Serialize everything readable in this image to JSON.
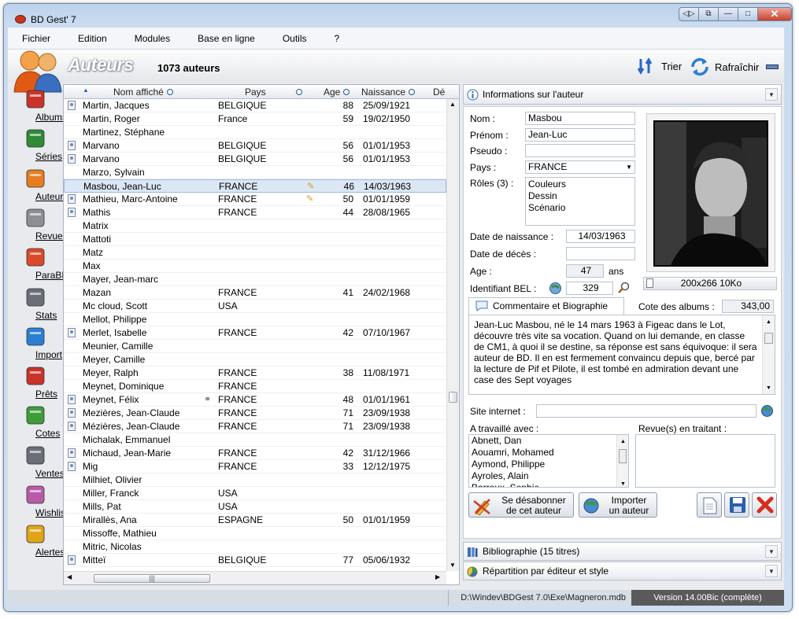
{
  "window": {
    "title": "BD Gest' 7"
  },
  "menu": [
    "Fichier",
    "Edition",
    "Modules",
    "Base en ligne",
    "Outils",
    "?"
  ],
  "header": {
    "title": "Auteurs",
    "count": "1073 auteurs",
    "sort_label": "Trier",
    "refresh_label": "Rafraîchir"
  },
  "sidebar": [
    {
      "label": "Albums",
      "icon": "albums-icon"
    },
    {
      "label": "Séries",
      "icon": "series-icon"
    },
    {
      "label": "Auteurs",
      "icon": "authors-icon"
    },
    {
      "label": "Revues",
      "icon": "magazines-icon"
    },
    {
      "label": "ParaBD",
      "icon": "parabd-icon"
    },
    {
      "label": "Stats",
      "icon": "stats-icon"
    },
    {
      "label": "Import",
      "icon": "import-icon"
    },
    {
      "label": "Prêts",
      "icon": "loans-icon"
    },
    {
      "label": "Cotes",
      "icon": "prices-icon"
    },
    {
      "label": "Ventes",
      "icon": "sales-icon"
    },
    {
      "label": "Wishlist",
      "icon": "wishlist-icon"
    },
    {
      "label": "Alertes",
      "icon": "alerts-icon"
    }
  ],
  "list": {
    "columns": {
      "name": "Nom affiché",
      "country": "Pays",
      "age": "Age",
      "birth": "Naissance",
      "death": "Dé"
    },
    "rows": [
      {
        "name": "Martin, Jacques",
        "country": "BELGIQUE",
        "age": "88",
        "birth": "25/09/1921",
        "icon": true
      },
      {
        "name": "Martin, Roger",
        "country": "France",
        "age": "59",
        "birth": "19/02/1950",
        "icon": false
      },
      {
        "name": "Martinez, Stéphane",
        "country": "",
        "age": "",
        "birth": "",
        "icon": false
      },
      {
        "name": "Marvano",
        "country": "BELGIQUE",
        "age": "56",
        "birth": "01/01/1953",
        "icon": true
      },
      {
        "name": "Marvano",
        "country": "BELGIQUE",
        "age": "56",
        "birth": "01/01/1953",
        "icon": true
      },
      {
        "name": "Marzo, Sylvain",
        "country": "",
        "age": "",
        "birth": "",
        "icon": false
      },
      {
        "name": "Masbou, Jean-Luc",
        "country": "FRANCE",
        "age": "46",
        "birth": "14/03/1963",
        "icon": false,
        "selected": true,
        "mark": "pen"
      },
      {
        "name": "Mathieu, Marc-Antoine",
        "country": "FRANCE",
        "age": "50",
        "birth": "01/01/1959",
        "icon": true,
        "mark": "pen"
      },
      {
        "name": "Mathis",
        "country": "FRANCE",
        "age": "44",
        "birth": "28/08/1965",
        "icon": true
      },
      {
        "name": "Matrix",
        "country": "",
        "age": "",
        "birth": "",
        "icon": false
      },
      {
        "name": "Mattoti",
        "country": "",
        "age": "",
        "birth": "",
        "icon": false
      },
      {
        "name": "Matz",
        "country": "",
        "age": "",
        "birth": "",
        "icon": false
      },
      {
        "name": "Max",
        "country": "",
        "age": "",
        "birth": "",
        "icon": false
      },
      {
        "name": "Mayer, Jean-marc",
        "country": "",
        "age": "",
        "birth": "",
        "icon": false
      },
      {
        "name": "Mazan",
        "country": "FRANCE",
        "age": "41",
        "birth": "24/02/1968",
        "icon": false
      },
      {
        "name": "Mc cloud, Scott",
        "country": "USA",
        "age": "",
        "birth": "",
        "icon": false
      },
      {
        "name": "Mellot, Philippe",
        "country": "",
        "age": "",
        "birth": "",
        "icon": false
      },
      {
        "name": "Merlet, Isabelle",
        "country": "FRANCE",
        "age": "42",
        "birth": "07/10/1967",
        "icon": true
      },
      {
        "name": "Meunier, Camille",
        "country": "",
        "age": "",
        "birth": "",
        "icon": false
      },
      {
        "name": "Meyer, Camille",
        "country": "",
        "age": "",
        "birth": "",
        "icon": false
      },
      {
        "name": "Meyer, Ralph",
        "country": "FRANCE",
        "age": "38",
        "birth": "11/08/1971",
        "icon": false
      },
      {
        "name": "Meynet, Dominique",
        "country": "FRANCE",
        "age": "",
        "birth": "",
        "icon": false
      },
      {
        "name": "Meynet, Félix",
        "country": "FRANCE",
        "age": "48",
        "birth": "01/01/1961",
        "icon": true,
        "mark": "link"
      },
      {
        "name": "Mezières, Jean-Claude",
        "country": "FRANCE",
        "age": "71",
        "birth": "23/09/1938",
        "icon": true
      },
      {
        "name": "Mézières, Jean-Claude",
        "country": "FRANCE",
        "age": "71",
        "birth": "23/09/1938",
        "icon": true
      },
      {
        "name": "Michalak, Emmanuel",
        "country": "",
        "age": "",
        "birth": "",
        "icon": false
      },
      {
        "name": "Michaud, Jean-Marie",
        "country": "FRANCE",
        "age": "42",
        "birth": "31/12/1966",
        "icon": true
      },
      {
        "name": "Mig",
        "country": "FRANCE",
        "age": "33",
        "birth": "12/12/1975",
        "icon": true
      },
      {
        "name": "Milhiet, Olivier",
        "country": "",
        "age": "",
        "birth": "",
        "icon": false
      },
      {
        "name": "Miller, Franck",
        "country": "USA",
        "age": "",
        "birth": "",
        "icon": false
      },
      {
        "name": "Mills, Pat",
        "country": "USA",
        "age": "",
        "birth": "",
        "icon": false
      },
      {
        "name": "Mirallès, Ana",
        "country": "ESPAGNE",
        "age": "50",
        "birth": "01/01/1959",
        "icon": false
      },
      {
        "name": "Missoffe, Mathieu",
        "country": "",
        "age": "",
        "birth": "",
        "icon": false
      },
      {
        "name": "Mitric, Nicolas",
        "country": "",
        "age": "",
        "birth": "",
        "icon": false
      },
      {
        "name": "Mitteï",
        "country": "BELGIQUE",
        "age": "77",
        "birth": "05/06/1932",
        "icon": true
      }
    ]
  },
  "detail": {
    "header": "Informations sur l'auteur",
    "labels": {
      "nom": "Nom :",
      "prenom": "Prénom :",
      "pseudo": "Pseudo :",
      "pays": "Pays :",
      "roles": "Rôles (3) :",
      "naissance": "Date de naissance :",
      "deces": "Date de décès :",
      "age": "Age :",
      "ans": "ans",
      "bel": "Identifiant BEL :",
      "cote": "Cote des albums :",
      "site": "Site internet :",
      "travaille": "A travaillé avec :",
      "revues": "Revue(s) en traitant :"
    },
    "values": {
      "nom": "Masbou",
      "prenom": "Jean-Luc",
      "pseudo": "",
      "pays": "FRANCE",
      "naissance": "14/03/1963",
      "deces": "",
      "age": "47",
      "bel": "329",
      "cote": "343,00",
      "site": "",
      "photo_info": "200x266 10Ko"
    },
    "roles": [
      "Couleurs",
      "Dessin",
      "Scénario"
    ],
    "bio_tab": "Commentaire et Biographie",
    "bio": "Jean-Luc Masbou, né le 14 mars 1963 à Figeac dans le Lot, découvre très vite sa vocation. Quand on lui demande, en classe de CM1, à quoi il se destine, sa réponse est sans équivoque: il sera auteur de BD. Il en est fermement convaincu depuis que, bercé par la lecture de Pif et Pilote, il est tombé en admiration devant une case des Sept voyages",
    "coworkers": [
      "Abnett, Dan",
      "Aouamri, Mohamed",
      "Aymond, Philippe",
      "Ayroles, Alain",
      "Barroux, Sophie"
    ],
    "btn_unsub": [
      "Se désabonner",
      "de cet auteur"
    ],
    "btn_import": [
      "Importer",
      "un auteur"
    ],
    "bibliographie": "Bibliographie (15 titres)",
    "repartition": "Répartition par éditeur et style"
  },
  "status": {
    "path": "D:\\Windev\\BDGest 7.0\\Exe\\Magneron.mdb",
    "version": "Version 14.00Bic (complète)"
  }
}
